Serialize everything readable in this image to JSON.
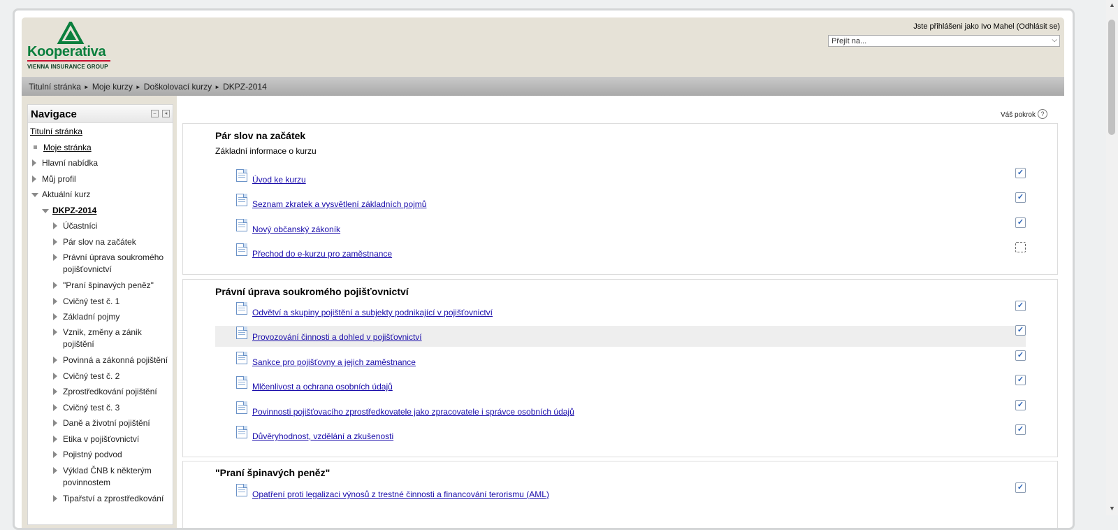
{
  "brand": {
    "name": "Kooperativa",
    "subtitle": "VIENNA INSURANCE GROUP",
    "color": "#0a7f3d"
  },
  "header": {
    "login_text": "Jste přihlášeni jako Ivo Mahel (Odhlásit se)",
    "jump_placeholder": "Přejít na..."
  },
  "breadcrumb": [
    "Titulní stránka",
    "Moje kurzy",
    "Doškolovací kurzy",
    "DKPZ-2014"
  ],
  "navigation": {
    "title": "Navigace",
    "home": "Titulní stránka",
    "my_page": "Moje stránka",
    "main_menu": "Hlavní nabídka",
    "my_profile": "Můj profil",
    "current_course": "Aktuální kurz",
    "course": "DKPZ-2014",
    "items": [
      "Účastníci",
      "Pár slov na začátek",
      "Právní úprava soukromého pojišťovnictví",
      "\"Praní špinavých peněz\"",
      "Cvičný test č. 1",
      "Základní pojmy",
      "Vznik, změny a zánik pojištění",
      "Povinná a zákonná pojištění",
      "Cvičný test č. 2",
      "Zprostředkování pojištění",
      "Cvičný test č. 3",
      "Daně a životní pojištění",
      "Etika v pojišťovnictví",
      "Pojistný podvod",
      "Výklad ČNB k některým povinnostem",
      "Tipařství a zprostředkování"
    ]
  },
  "progress_label": "Váš pokrok",
  "sections": [
    {
      "title": "Pár slov na začátek",
      "summary": "Základní informace o kurzu",
      "activities": [
        {
          "label": "Úvod ke kurzu",
          "done": true
        },
        {
          "label": "Seznam zkratek a vysvětlení základních pojmů",
          "done": true
        },
        {
          "label": "Nový občanský zákoník",
          "done": true
        },
        {
          "label": "Přechod do e-kurzu pro zaměstnance",
          "done": false
        }
      ]
    },
    {
      "title": "Právní úprava soukromého pojišťovnictví",
      "activities": [
        {
          "label": "Odvětví a skupiny pojištění a subjekty podnikající v pojišťovnictví",
          "done": true
        },
        {
          "label": "Provozování činnosti a dohled v pojišťovnictví",
          "done": true
        },
        {
          "label": "Sankce pro pojišťovny a jejich zaměstnance",
          "done": true
        },
        {
          "label": "Mlčenlivost a ochrana osobních údajů",
          "done": true
        },
        {
          "label": "Povinnosti pojišťovacího zprostředkovatele jako zpracovatele i správce osobních údajů",
          "done": true
        },
        {
          "label": "Důvěryhodnost, vzdělání a zkušenosti",
          "done": true
        }
      ]
    },
    {
      "title": "\"Praní špinavých peněz\"",
      "activities": [
        {
          "label": "Opatření proti legalizaci výnosů z trestné činnosti a financování terorismu (AML)",
          "done": true
        }
      ]
    }
  ]
}
